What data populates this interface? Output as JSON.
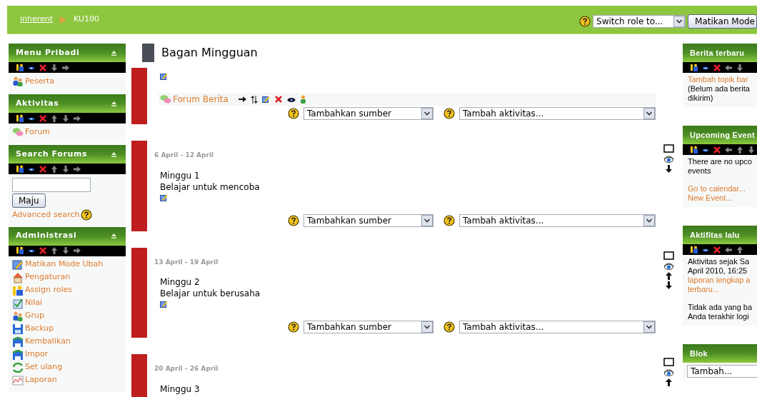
{
  "breadcrumb": [
    {
      "kind": "link",
      "label": "inherent"
    },
    {
      "kind": "current",
      "label": "KU100"
    }
  ],
  "role_select": {
    "value": "Switch role to..."
  },
  "edit_mode_button": "Matikan Mode",
  "left_blocks": [
    {
      "kind": "links",
      "title": "Menu Pribadi",
      "controls": [
        {
          "kind": "roles"
        },
        {
          "kind": "hide"
        },
        {
          "kind": "delete"
        },
        {
          "kind": "down"
        },
        {
          "kind": "move"
        }
      ],
      "items": [
        {
          "kind": "participants",
          "label": "Peserta"
        }
      ]
    },
    {
      "kind": "links",
      "title": "Aktivitas",
      "controls": [
        {
          "kind": "roles"
        },
        {
          "kind": "hide"
        },
        {
          "kind": "delete"
        },
        {
          "kind": "up"
        },
        {
          "kind": "down"
        },
        {
          "kind": "move"
        }
      ],
      "items": [
        {
          "kind": "forum",
          "label": "Forum"
        }
      ]
    },
    {
      "kind": "search",
      "title": "Search Forums",
      "controls": [
        {
          "kind": "roles"
        },
        {
          "kind": "hide"
        },
        {
          "kind": "delete"
        },
        {
          "kind": "up"
        },
        {
          "kind": "down"
        },
        {
          "kind": "move"
        }
      ],
      "button": "Maju",
      "link": "Advanced search"
    },
    {
      "kind": "links",
      "title": "Administrasi",
      "controls": [
        {
          "kind": "roles"
        },
        {
          "kind": "hide"
        },
        {
          "kind": "delete"
        },
        {
          "kind": "up"
        },
        {
          "kind": "down"
        },
        {
          "kind": "move"
        }
      ],
      "items": [
        {
          "kind": "edit",
          "label": "Matikan Mode Ubah"
        },
        {
          "kind": "settings",
          "label": "Pengaturan"
        },
        {
          "kind": "roles",
          "label": "Assign roles"
        },
        {
          "kind": "grades",
          "label": "Nilai"
        },
        {
          "kind": "groups",
          "label": "Grup"
        },
        {
          "kind": "backup",
          "label": "Backup"
        },
        {
          "kind": "restore",
          "label": "Kembalikan"
        },
        {
          "kind": "restore",
          "label": "Impor"
        },
        {
          "kind": "reset",
          "label": "Set ulang"
        },
        {
          "kind": "reports",
          "label": "Laporan"
        }
      ]
    }
  ],
  "heading": "Bagan Mingguan",
  "sections": [
    {
      "kind": "general",
      "forum": "Forum Berita",
      "resource_select": "Tambahkan sumber",
      "activity_select": "Tambah aktivitas..."
    },
    {
      "kind": "week",
      "dates": "6 April - 12 April",
      "title": "Minggu 1",
      "summary": "Belajar untuk mencoba",
      "controls": [
        {
          "kind": "highlight"
        },
        {
          "kind": "hide"
        },
        {
          "kind": "down"
        }
      ],
      "resource_select": "Tambahkan sumber",
      "activity_select": "Tambah aktivitas..."
    },
    {
      "kind": "week",
      "dates": "13 April - 19 April",
      "title": "Minggu 2",
      "summary": "Belajar untuk berusaha",
      "controls": [
        {
          "kind": "highlight"
        },
        {
          "kind": "hide"
        },
        {
          "kind": "up"
        },
        {
          "kind": "down"
        }
      ],
      "resource_select": "Tambahkan sumber",
      "activity_select": "Tambah aktivitas..."
    },
    {
      "kind": "week",
      "dates": "20 April - 26 April",
      "title": "Minggu 3",
      "controls": [
        {
          "kind": "highlight"
        },
        {
          "kind": "hide"
        },
        {
          "kind": "up"
        }
      ]
    }
  ],
  "right_blocks": [
    {
      "kind": "text",
      "title": "Berita terbaru",
      "controls": [
        {
          "kind": "roles"
        },
        {
          "kind": "hide"
        },
        {
          "kind": "delete"
        },
        {
          "kind": "left"
        },
        {
          "kind": "down"
        }
      ],
      "paragraphs": [
        [
          {
            "kind": "link",
            "text": "Tambah topik bar"
          },
          {
            "kind": "text",
            "text": "(Belum ada berita"
          },
          {
            "kind": "text",
            "text": "dikirim)"
          }
        ]
      ]
    },
    {
      "kind": "text",
      "title": "Upcoming Event",
      "controls": [
        {
          "kind": "roles"
        },
        {
          "kind": "hide"
        },
        {
          "kind": "delete"
        },
        {
          "kind": "left"
        },
        {
          "kind": "up"
        },
        {
          "kind": "down"
        }
      ],
      "paragraphs": [
        [
          {
            "kind": "text",
            "text": "There are no upco"
          },
          {
            "kind": "text",
            "text": "events"
          }
        ],
        [
          {
            "kind": "link",
            "text": "Go to calendar..."
          },
          {
            "kind": "link",
            "text": "New Event..."
          }
        ]
      ]
    },
    {
      "kind": "text",
      "title": "Aktifitas lalu",
      "controls": [
        {
          "kind": "roles"
        },
        {
          "kind": "hide"
        },
        {
          "kind": "delete"
        },
        {
          "kind": "left"
        },
        {
          "kind": "up"
        }
      ],
      "paragraphs": [
        [
          {
            "kind": "text",
            "text": "Aktivitas sejak Sa"
          },
          {
            "kind": "text",
            "text": "April 2010, 16:25"
          },
          {
            "kind": "link",
            "text": "laporan lengkap a"
          },
          {
            "kind": "link",
            "text": "terbaru..."
          }
        ],
        [
          {
            "kind": "text",
            "text": "Tidak ada yang ba"
          },
          {
            "kind": "text",
            "text": "Anda terakhir logi"
          }
        ]
      ]
    },
    {
      "kind": "add",
      "title": "Blok",
      "select": "Tambah..."
    }
  ]
}
